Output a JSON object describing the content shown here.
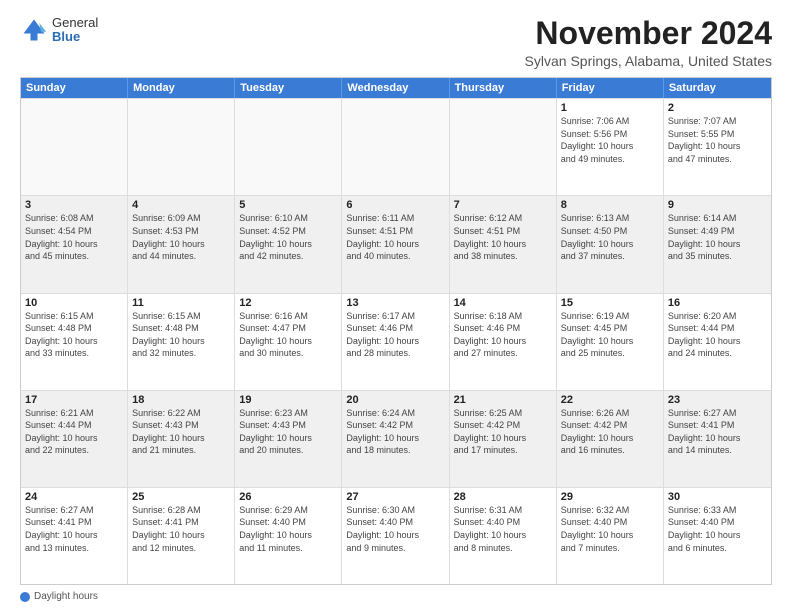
{
  "header": {
    "logo": {
      "general": "General",
      "blue": "Blue"
    },
    "title": "November 2024",
    "location": "Sylvan Springs, Alabama, United States"
  },
  "calendar": {
    "days_of_week": [
      "Sunday",
      "Monday",
      "Tuesday",
      "Wednesday",
      "Thursday",
      "Friday",
      "Saturday"
    ],
    "weeks": [
      [
        {
          "day": "",
          "info": ""
        },
        {
          "day": "",
          "info": ""
        },
        {
          "day": "",
          "info": ""
        },
        {
          "day": "",
          "info": ""
        },
        {
          "day": "",
          "info": ""
        },
        {
          "day": "1",
          "info": "Sunrise: 7:06 AM\nSunset: 5:56 PM\nDaylight: 10 hours\nand 49 minutes."
        },
        {
          "day": "2",
          "info": "Sunrise: 7:07 AM\nSunset: 5:55 PM\nDaylight: 10 hours\nand 47 minutes."
        }
      ],
      [
        {
          "day": "3",
          "info": "Sunrise: 6:08 AM\nSunset: 4:54 PM\nDaylight: 10 hours\nand 45 minutes."
        },
        {
          "day": "4",
          "info": "Sunrise: 6:09 AM\nSunset: 4:53 PM\nDaylight: 10 hours\nand 44 minutes."
        },
        {
          "day": "5",
          "info": "Sunrise: 6:10 AM\nSunset: 4:52 PM\nDaylight: 10 hours\nand 42 minutes."
        },
        {
          "day": "6",
          "info": "Sunrise: 6:11 AM\nSunset: 4:51 PM\nDaylight: 10 hours\nand 40 minutes."
        },
        {
          "day": "7",
          "info": "Sunrise: 6:12 AM\nSunset: 4:51 PM\nDaylight: 10 hours\nand 38 minutes."
        },
        {
          "day": "8",
          "info": "Sunrise: 6:13 AM\nSunset: 4:50 PM\nDaylight: 10 hours\nand 37 minutes."
        },
        {
          "day": "9",
          "info": "Sunrise: 6:14 AM\nSunset: 4:49 PM\nDaylight: 10 hours\nand 35 minutes."
        }
      ],
      [
        {
          "day": "10",
          "info": "Sunrise: 6:15 AM\nSunset: 4:48 PM\nDaylight: 10 hours\nand 33 minutes."
        },
        {
          "day": "11",
          "info": "Sunrise: 6:15 AM\nSunset: 4:48 PM\nDaylight: 10 hours\nand 32 minutes."
        },
        {
          "day": "12",
          "info": "Sunrise: 6:16 AM\nSunset: 4:47 PM\nDaylight: 10 hours\nand 30 minutes."
        },
        {
          "day": "13",
          "info": "Sunrise: 6:17 AM\nSunset: 4:46 PM\nDaylight: 10 hours\nand 28 minutes."
        },
        {
          "day": "14",
          "info": "Sunrise: 6:18 AM\nSunset: 4:46 PM\nDaylight: 10 hours\nand 27 minutes."
        },
        {
          "day": "15",
          "info": "Sunrise: 6:19 AM\nSunset: 4:45 PM\nDaylight: 10 hours\nand 25 minutes."
        },
        {
          "day": "16",
          "info": "Sunrise: 6:20 AM\nSunset: 4:44 PM\nDaylight: 10 hours\nand 24 minutes."
        }
      ],
      [
        {
          "day": "17",
          "info": "Sunrise: 6:21 AM\nSunset: 4:44 PM\nDaylight: 10 hours\nand 22 minutes."
        },
        {
          "day": "18",
          "info": "Sunrise: 6:22 AM\nSunset: 4:43 PM\nDaylight: 10 hours\nand 21 minutes."
        },
        {
          "day": "19",
          "info": "Sunrise: 6:23 AM\nSunset: 4:43 PM\nDaylight: 10 hours\nand 20 minutes."
        },
        {
          "day": "20",
          "info": "Sunrise: 6:24 AM\nSunset: 4:42 PM\nDaylight: 10 hours\nand 18 minutes."
        },
        {
          "day": "21",
          "info": "Sunrise: 6:25 AM\nSunset: 4:42 PM\nDaylight: 10 hours\nand 17 minutes."
        },
        {
          "day": "22",
          "info": "Sunrise: 6:26 AM\nSunset: 4:42 PM\nDaylight: 10 hours\nand 16 minutes."
        },
        {
          "day": "23",
          "info": "Sunrise: 6:27 AM\nSunset: 4:41 PM\nDaylight: 10 hours\nand 14 minutes."
        }
      ],
      [
        {
          "day": "24",
          "info": "Sunrise: 6:27 AM\nSunset: 4:41 PM\nDaylight: 10 hours\nand 13 minutes."
        },
        {
          "day": "25",
          "info": "Sunrise: 6:28 AM\nSunset: 4:41 PM\nDaylight: 10 hours\nand 12 minutes."
        },
        {
          "day": "26",
          "info": "Sunrise: 6:29 AM\nSunset: 4:40 PM\nDaylight: 10 hours\nand 11 minutes."
        },
        {
          "day": "27",
          "info": "Sunrise: 6:30 AM\nSunset: 4:40 PM\nDaylight: 10 hours\nand 9 minutes."
        },
        {
          "day": "28",
          "info": "Sunrise: 6:31 AM\nSunset: 4:40 PM\nDaylight: 10 hours\nand 8 minutes."
        },
        {
          "day": "29",
          "info": "Sunrise: 6:32 AM\nSunset: 4:40 PM\nDaylight: 10 hours\nand 7 minutes."
        },
        {
          "day": "30",
          "info": "Sunrise: 6:33 AM\nSunset: 4:40 PM\nDaylight: 10 hours\nand 6 minutes."
        }
      ]
    ]
  },
  "legend": {
    "daylight_label": "Daylight hours"
  }
}
